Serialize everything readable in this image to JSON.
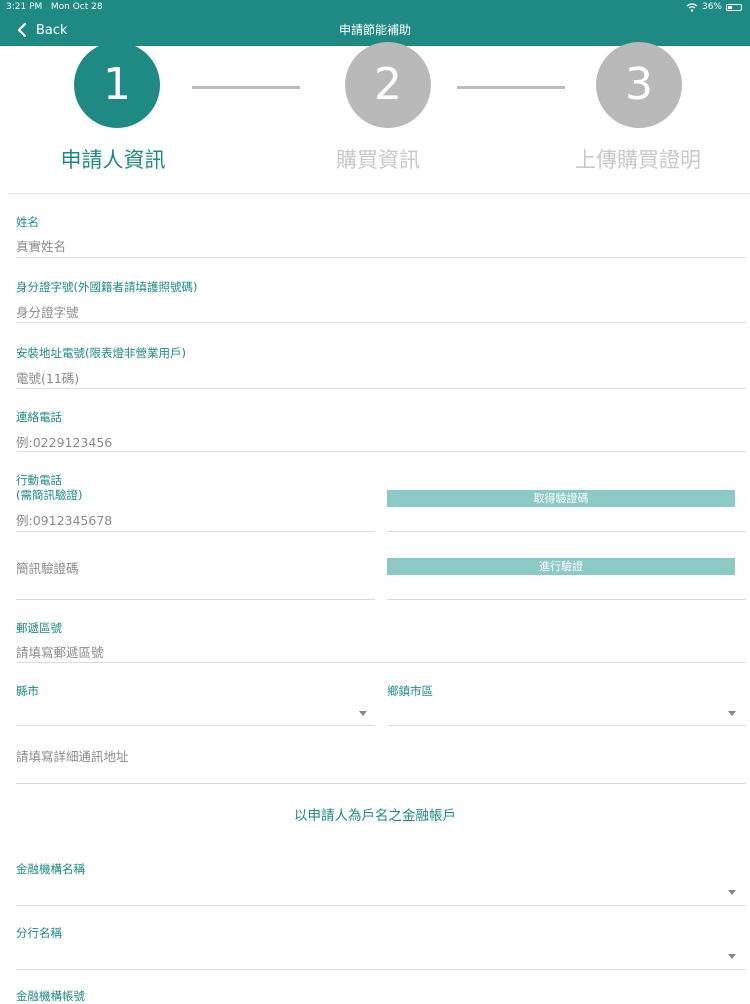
{
  "status": {
    "time": "3:21 PM",
    "date": "Mon Oct 28",
    "battery": "36%",
    "battery_level": 0.36
  },
  "nav": {
    "back_label": "Back",
    "title": "申請節能補助"
  },
  "steps": [
    {
      "num": "1",
      "label": "申請人資訊",
      "active": true
    },
    {
      "num": "2",
      "label": "購買資訊",
      "active": false
    },
    {
      "num": "3",
      "label": "上傳購買證明",
      "active": false
    }
  ],
  "form": {
    "name": {
      "label": "姓名",
      "placeholder": "真實姓名"
    },
    "id_number": {
      "label": "身分證字號(外國籍者請填護照號碼)",
      "placeholder": "身分證字號"
    },
    "meter": {
      "label": "安裝地址電號(限表燈非營業用戶)",
      "placeholder": "電號(11碼)"
    },
    "phone": {
      "label": "連絡電話",
      "placeholder": "例:0229123456"
    },
    "mobile": {
      "label_line1": "行動電話",
      "label_line2": "(需簡訊驗證)",
      "placeholder": "例:0912345678",
      "button": "取得驗證碼"
    },
    "sms_code": {
      "placeholder": "簡訊驗證碼",
      "button": "進行驗證"
    },
    "zip": {
      "label": "郵遞區號",
      "placeholder": "請填寫郵遞區號"
    },
    "county": {
      "label": "縣市"
    },
    "township": {
      "label": "鄉鎮市區"
    },
    "address": {
      "placeholder": "請填寫詳細通訊地址"
    }
  },
  "bank": {
    "section_title": "以申請人為戶名之金融帳戶",
    "institution": {
      "label": "金融機構名稱"
    },
    "branch": {
      "label": "分行名稱"
    },
    "account": {
      "label": "金融機構帳號"
    }
  }
}
